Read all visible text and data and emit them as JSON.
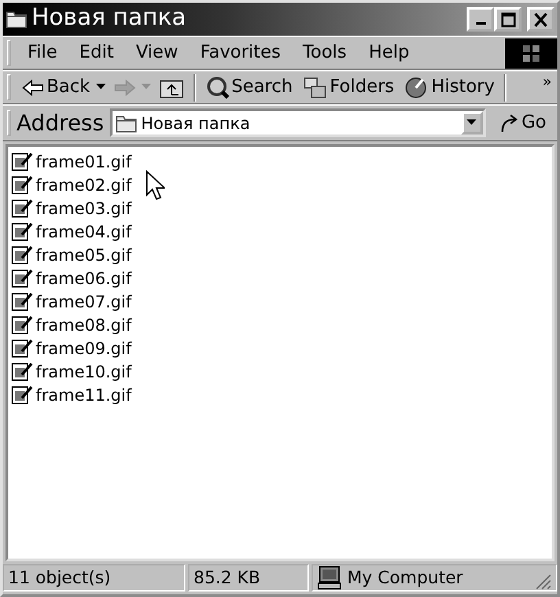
{
  "window": {
    "title": "Новая папка"
  },
  "menu": [
    "File",
    "Edit",
    "View",
    "Favorites",
    "Tools",
    "Help"
  ],
  "toolbar": [
    {
      "kind": "back",
      "label": "Back",
      "disabled": false
    },
    {
      "kind": "forward",
      "disabled": true
    },
    {
      "kind": "up"
    },
    {
      "kind": "search",
      "label": "Search"
    },
    {
      "kind": "folders",
      "label": "Folders"
    },
    {
      "kind": "history",
      "label": "History"
    }
  ],
  "toolbar_more": "»",
  "address": {
    "label": "Address",
    "value": "Новая папка",
    "go": "Go"
  },
  "files": [
    "frame01.gif",
    "frame02.gif",
    "frame03.gif",
    "frame04.gif",
    "frame05.gif",
    "frame06.gif",
    "frame07.gif",
    "frame08.gif",
    "frame09.gif",
    "frame10.gif",
    "frame11.gif"
  ],
  "status_bar": {
    "objects": "11 object(s)",
    "size": "85.2 KB",
    "zone": "My Computer"
  }
}
